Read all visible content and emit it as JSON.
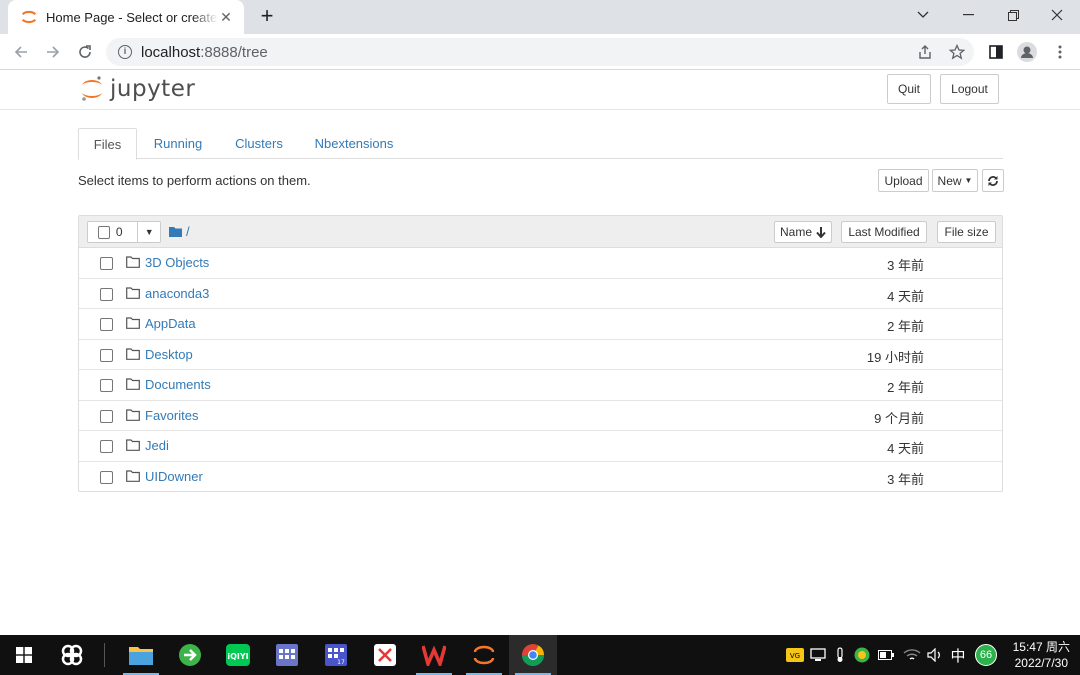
{
  "browser": {
    "tab_title": "Home Page - Select or create a notebook",
    "url_host": "localhost",
    "url_rest": ":8888/tree"
  },
  "header": {
    "logo_text": "jupyter",
    "quit_label": "Quit",
    "logout_label": "Logout"
  },
  "tabs": [
    {
      "label": "Files"
    },
    {
      "label": "Running"
    },
    {
      "label": "Clusters"
    },
    {
      "label": "Nbextensions"
    }
  ],
  "toolbar": {
    "hint": "Select items to perform actions on them.",
    "upload_label": "Upload",
    "new_label": "New"
  },
  "list": {
    "selected_count": "0",
    "breadcrumb": "/",
    "col_name": "Name",
    "col_modified": "Last Modified",
    "col_size": "File size",
    "rows": [
      {
        "name": "3D Objects",
        "modified": "3 年前"
      },
      {
        "name": "anaconda3",
        "modified": "4 天前"
      },
      {
        "name": "AppData",
        "modified": "2 年前"
      },
      {
        "name": "Desktop",
        "modified": "19 小时前"
      },
      {
        "name": "Documents",
        "modified": "2 年前"
      },
      {
        "name": "Favorites",
        "modified": "9 个月前"
      },
      {
        "name": "Jedi",
        "modified": "4 天前"
      },
      {
        "name": "UIDowner",
        "modified": "3 年前"
      }
    ]
  },
  "taskbar": {
    "ime": "中",
    "badge": "66",
    "time": "15:47 周六",
    "date": "2022/7/30"
  },
  "colors": {
    "link": "#337ab7",
    "jupyter_orange": "#f37726"
  }
}
